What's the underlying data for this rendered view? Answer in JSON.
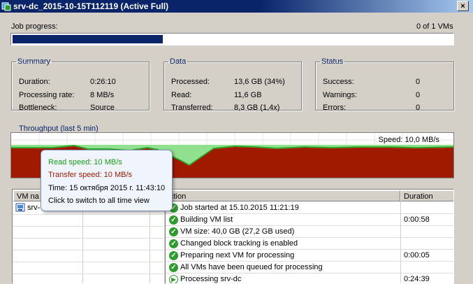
{
  "window": {
    "title": "srv-dc_2015-10-15T112119 (Active Full)",
    "close_glyph": "×"
  },
  "progress": {
    "label": "Job progress:",
    "status": "0 of 1 VMs",
    "fraction": 0.34
  },
  "summary": {
    "title": "Summary",
    "rows": [
      {
        "label": "Duration:",
        "value": "0:26:10"
      },
      {
        "label": "Processing rate:",
        "value": "8 MB/s"
      },
      {
        "label": "Bottleneck:",
        "value": "Source"
      }
    ]
  },
  "data": {
    "title": "Data",
    "rows": [
      {
        "label": "Processed:",
        "value": "13,6 GB (34%)"
      },
      {
        "label": "Read:",
        "value": "11,6 GB"
      },
      {
        "label": "Transferred:",
        "value": "8,3 GB (1,4x)"
      }
    ]
  },
  "status": {
    "title": "Status",
    "rows": [
      {
        "label": "Success:",
        "value": "0"
      },
      {
        "label": "Warnings:",
        "value": "0"
      },
      {
        "label": "Errors:",
        "value": "0"
      }
    ]
  },
  "throughput": {
    "title": "Throughput (last 5 min)",
    "speed": "Speed: 10,0 MB/s",
    "colors": {
      "read": "#19a019",
      "transfer": "#a01a00",
      "read_area": "#90e090"
    }
  },
  "tooltip": {
    "read": "Read speed: 10 MB/s",
    "transfer": "Transfer speed: 10 MB/s",
    "time": "Time: 15 октября 2015 г. 11:43:10",
    "hint": "Click to switch to all time view"
  },
  "vm_list": {
    "header": "VM name",
    "header_visible": "VM na",
    "items": [
      {
        "name": "srv-dc",
        "visible": "srv-"
      }
    ]
  },
  "log": {
    "col_action": "Action",
    "col_action_visible": "ction",
    "col_duration": "Duration",
    "rows": [
      {
        "icon": "success",
        "text": "Job started at 15.10.2015 11:21:19",
        "duration": ""
      },
      {
        "icon": "success",
        "text": "Building VM list",
        "duration": "0:00:58"
      },
      {
        "icon": "success",
        "text": "VM size: 40,0 GB (27,2 GB used)",
        "duration": ""
      },
      {
        "icon": "success",
        "text": "Changed block tracking is enabled",
        "duration": ""
      },
      {
        "icon": "success",
        "text": "Preparing next VM for processing",
        "duration": "0:00:05"
      },
      {
        "icon": "success",
        "text": "All VMs have been queued for processing",
        "duration": ""
      },
      {
        "icon": "running",
        "text": "Processing srv-dc",
        "duration": "0:24:39"
      }
    ]
  }
}
